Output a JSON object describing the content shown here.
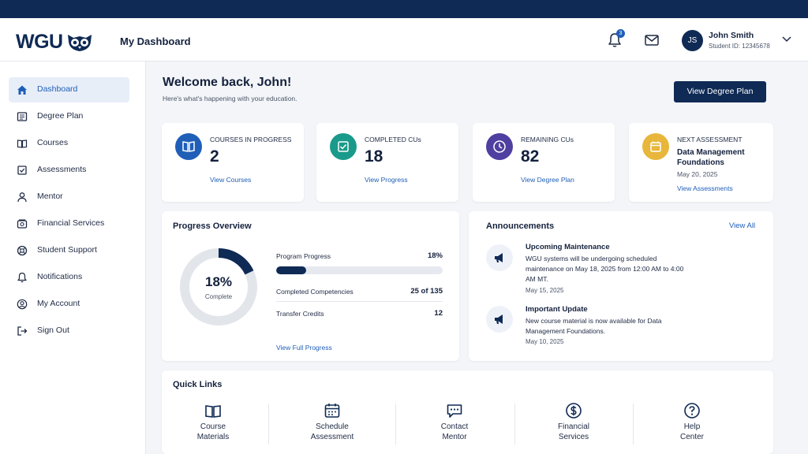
{
  "header": {
    "logo_text": "WGU",
    "title": "My Dashboard",
    "notification_count": "3",
    "user": {
      "initials": "JS",
      "name": "John Smith",
      "student_id": "Student ID: 12345678"
    }
  },
  "sidebar": {
    "items": [
      {
        "label": "Dashboard",
        "icon": "home-icon",
        "active": true
      },
      {
        "label": "Degree Plan",
        "icon": "plan-icon"
      },
      {
        "label": "Courses",
        "icon": "book-icon"
      },
      {
        "label": "Assessments",
        "icon": "checkbox-icon"
      },
      {
        "label": "Mentor",
        "icon": "person-icon"
      },
      {
        "label": "Financial Services",
        "icon": "money-icon"
      },
      {
        "label": "Student Support",
        "icon": "support-icon"
      },
      {
        "label": "Notifications",
        "icon": "bell-icon"
      },
      {
        "label": "My Account",
        "icon": "account-icon"
      },
      {
        "label": "Sign Out",
        "icon": "sign-out-icon"
      }
    ]
  },
  "welcome": {
    "title": "Welcome back, John!",
    "subtitle": "Here's what's happening with your education.",
    "button": "View Degree Plan"
  },
  "stats": [
    {
      "label": "COURSES IN PROGRESS",
      "value": "2",
      "link": "View Courses",
      "color": "#1f5fb8",
      "icon": "book-icon"
    },
    {
      "label": "COMPLETED CUs",
      "value": "18",
      "link": "View Progress",
      "color": "#1a9a8a",
      "icon": "check-icon"
    },
    {
      "label": "REMAINING CUs",
      "value": "82",
      "link": "View Degree Plan",
      "color": "#4f3fa0",
      "icon": "clock-icon"
    }
  ],
  "next_assessment": {
    "label": "NEXT ASSESSMENT",
    "name": "Data Management Foundations",
    "date": "May 20, 2025",
    "link": "View Assessments",
    "color": "#e8b63a"
  },
  "progress": {
    "title": "Progress Overview",
    "percent_text": "18%",
    "percent": 18,
    "complete_label": "Complete",
    "program_label": "Program Progress",
    "program_value": "18%",
    "competencies_label": "Completed Competencies",
    "competencies_value": "25 of 135",
    "transfer_label": "Transfer Credits",
    "transfer_value": "12",
    "link": "View Full Progress"
  },
  "announcements": {
    "title": "Announcements",
    "view_all": "View All",
    "items": [
      {
        "title": "Upcoming Maintenance",
        "body": "WGU systems will be undergoing scheduled maintenance on May 18, 2025 from 12:00 AM to 4:00 AM MT.",
        "date": "May 15, 2025"
      },
      {
        "title": "Important Update",
        "body": "New course material is now available for Data Management Foundations.",
        "date": "May 10, 2025"
      }
    ]
  },
  "quick_links": {
    "title": "Quick Links",
    "items": [
      {
        "line1": "Course",
        "line2": "Materials",
        "icon": "book-open-icon"
      },
      {
        "line1": "Schedule",
        "line2": "Assessment",
        "icon": "calendar-icon"
      },
      {
        "line1": "Contact",
        "line2": "Mentor",
        "icon": "chat-icon"
      },
      {
        "line1": "Financial",
        "line2": "Services",
        "icon": "dollar-icon"
      },
      {
        "line1": "Help",
        "line2": "Center",
        "icon": "help-icon"
      }
    ]
  }
}
